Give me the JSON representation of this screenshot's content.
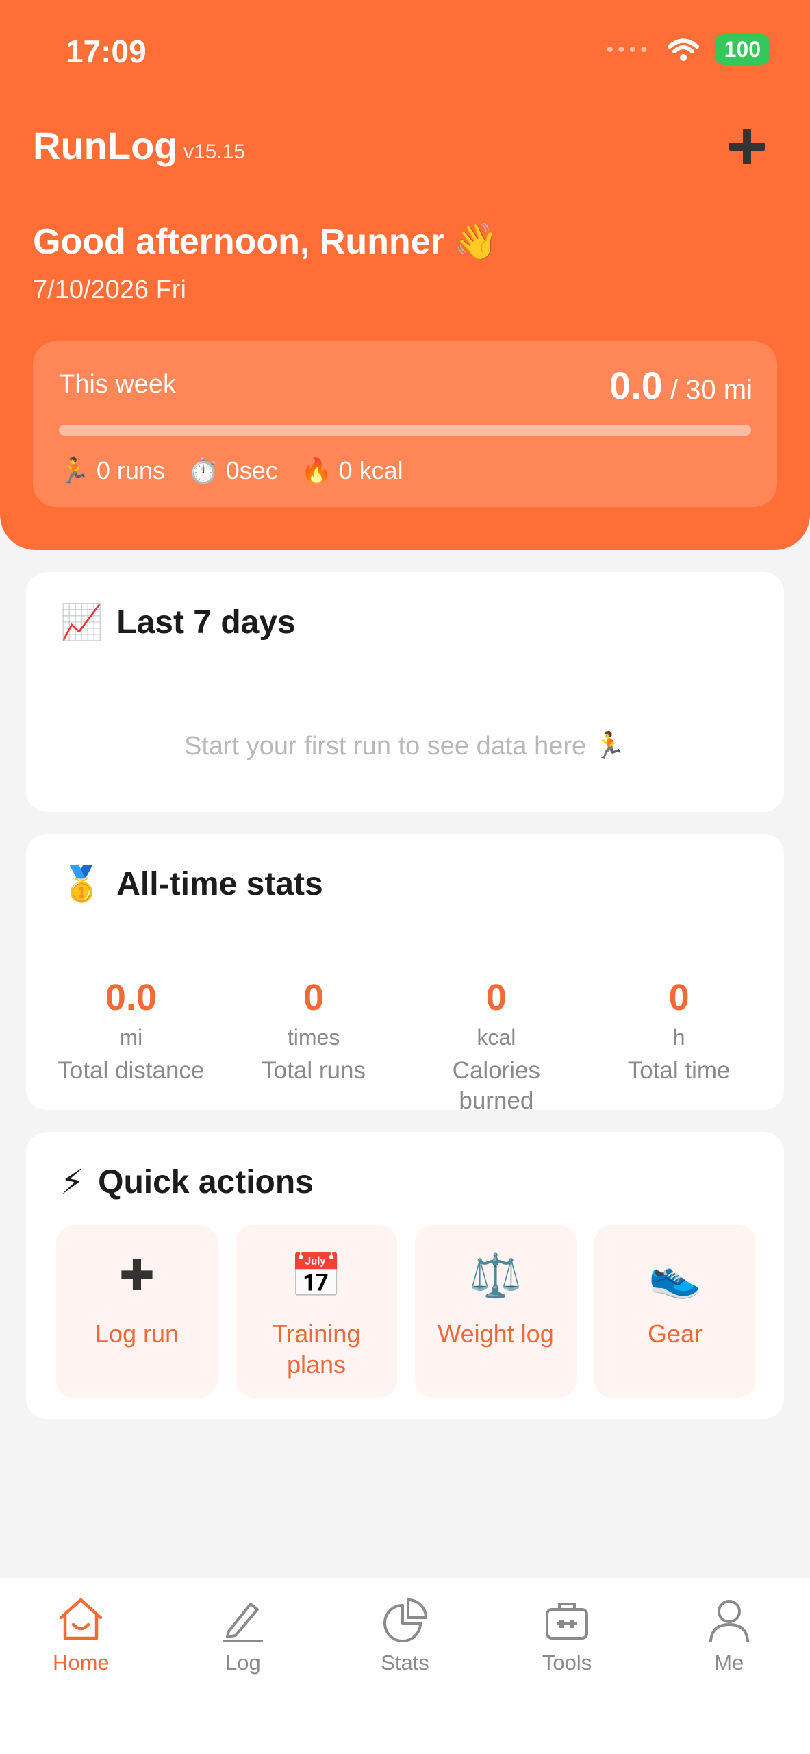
{
  "status": {
    "time": "17:09",
    "battery": "100",
    "signal": "••••"
  },
  "header": {
    "app_name": "RunLog",
    "version": "v15.15",
    "greeting": "Good afternoon, Runner 👋",
    "date": "7/10/2026 Fri"
  },
  "week": {
    "label": "This week",
    "distance": "0.0",
    "goal": "/ 30 mi",
    "progress": 0,
    "runs": "0 runs",
    "duration": "0sec",
    "calories": "0 kcal",
    "runs_icon": "🏃",
    "duration_icon": "⏱️",
    "calories_icon": "🔥"
  },
  "last7": {
    "icon": "📈",
    "title": "Last 7 days",
    "empty": "Start your first run to see data here 🏃"
  },
  "alltime": {
    "icon": "🥇",
    "title": "All-time stats",
    "stats": [
      {
        "value": "0.0",
        "unit": "mi",
        "label": "Total distance"
      },
      {
        "value": "0",
        "unit": "times",
        "label": "Total runs"
      },
      {
        "value": "0",
        "unit": "kcal",
        "label": "Calories burned"
      },
      {
        "value": "0",
        "unit": "h",
        "label": "Total time"
      }
    ]
  },
  "quick": {
    "icon": "⚡",
    "title": "Quick actions",
    "actions": [
      {
        "icon": "✚",
        "label": "Log run"
      },
      {
        "icon": "📅",
        "label": "Training plans"
      },
      {
        "icon": "⚖️",
        "label": "Weight log"
      },
      {
        "icon": "👟",
        "label": "Gear"
      }
    ]
  },
  "tabs": [
    {
      "label": "Home",
      "icon": "home-icon"
    },
    {
      "label": "Log",
      "icon": "pencil-icon"
    },
    {
      "label": "Stats",
      "icon": "pie-chart-icon"
    },
    {
      "label": "Tools",
      "icon": "toolbox-icon"
    },
    {
      "label": "Me",
      "icon": "person-icon"
    }
  ],
  "colors": {
    "brand": "#ff6e36",
    "accent": "#f26a35",
    "tab_inactive": "#8a8a8a"
  }
}
